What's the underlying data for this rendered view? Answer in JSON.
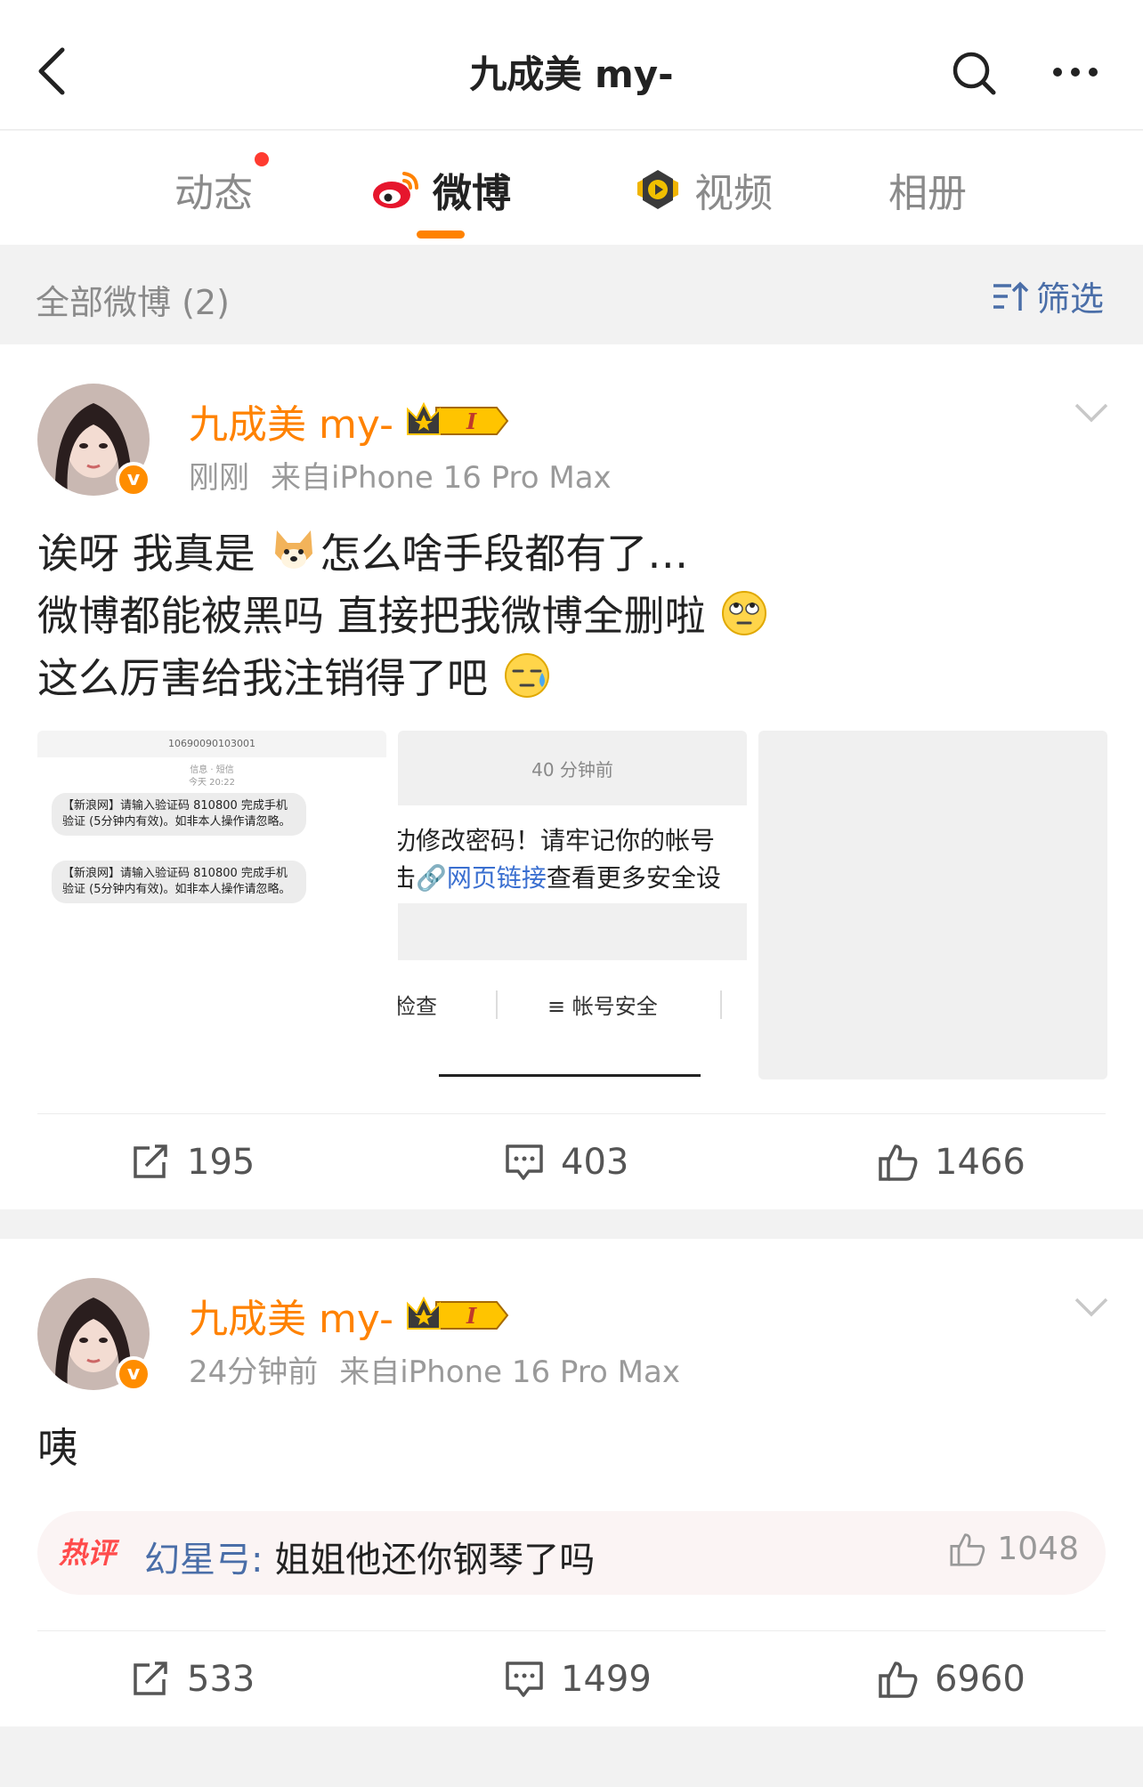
{
  "header": {
    "title": "九成美 my-"
  },
  "tabs": [
    {
      "label": "动态",
      "active": false,
      "has_dot": true
    },
    {
      "label": "微博",
      "active": true
    },
    {
      "label": "视频",
      "active": false
    },
    {
      "label": "相册",
      "active": false
    }
  ],
  "filter_bar": {
    "label": "全部微博 (2)",
    "button": "筛选"
  },
  "posts": [
    {
      "author": "九成美 my-",
      "time": "刚刚",
      "source": "来自iPhone 16 Pro Max",
      "lines": [
        "诶呀 我真是",
        "怎么啥手段都有了…",
        "微博都能被黑吗 直接把我微博全删啦",
        "这么厉害给我注销得了吧"
      ],
      "images": {
        "sms_number": "10690090103001",
        "sms_date": "信息 · 短信\n今天 20:22",
        "sms_1": "【新浪网】请输入验证码 810800 完成手机验证 (5分钟内有效)。如非本人操作请忽略。",
        "sms_2": "【新浪网】请输入验证码 810800 完成手机验证 (5分钟内有效)。如非本人操作请忽略。",
        "shot_time": "40 分钟前",
        "shot_line1": "功修改密码！请牢记你的帐号",
        "shot_line2_pre": "击",
        "shot_link": "🔗网页链接",
        "shot_line2_post": "查看更多安全设",
        "shot_check": "检查",
        "shot_security": "≡ 帐号安全"
      },
      "repost": "195",
      "comment": "403",
      "like": "1466"
    },
    {
      "author": "九成美 my-",
      "time": "24分钟前",
      "source": "来自iPhone 16 Pro Max",
      "text": "咦",
      "hot_comment": {
        "tag": "热评",
        "author": "幻星弓: ",
        "text": "姐姐他还你钢琴了吗",
        "likes": "1048"
      },
      "repost": "533",
      "comment": "1499",
      "like": "6960"
    }
  ],
  "colors": {
    "brand_orange": "#ff8200",
    "link_blue": "#4a6ea8",
    "badge_red": "#ff3b30"
  }
}
